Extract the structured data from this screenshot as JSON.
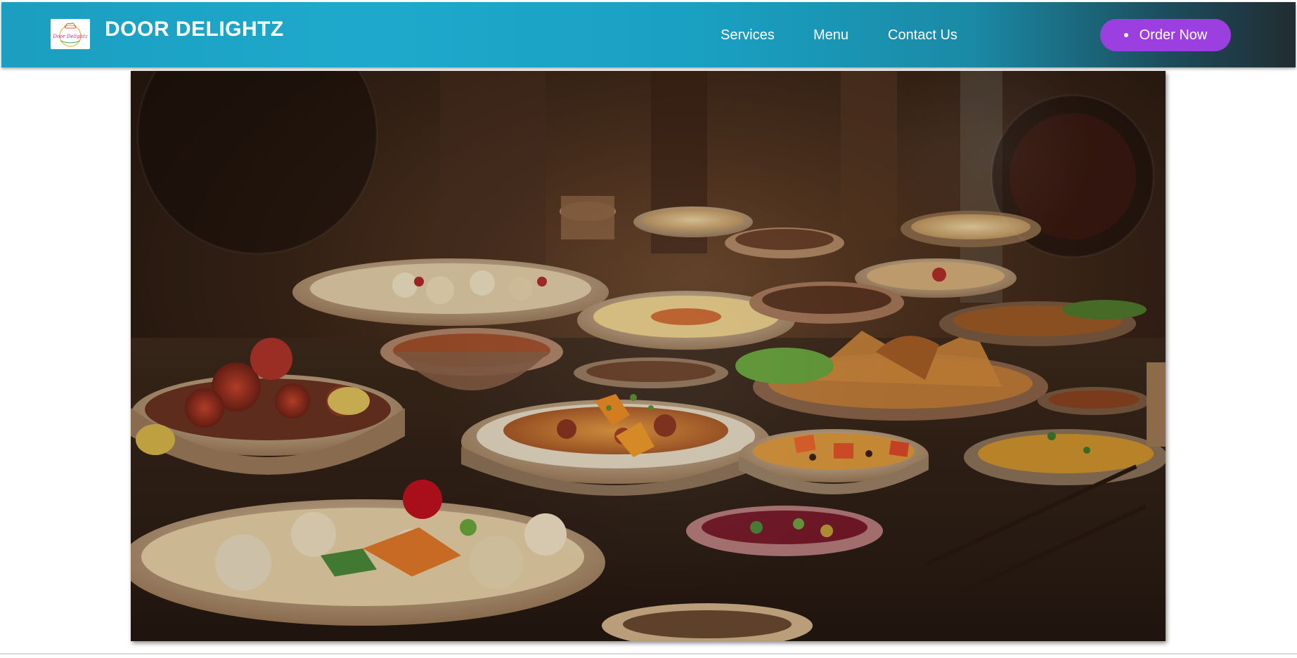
{
  "brand": {
    "name": "DOOR DELIGHTZ",
    "logo_text": "Door Delightz",
    "logo_icon": "chef-hat-icon"
  },
  "nav": {
    "items": [
      {
        "label": "Services"
      },
      {
        "label": "Menu"
      },
      {
        "label": "Contact Us"
      }
    ],
    "cta_label": "Order Now"
  },
  "colors": {
    "navbar_start": "#1b9ec0",
    "navbar_end": "#222c32",
    "cta": "#9b3fe0",
    "page_background": "#ffffff"
  },
  "hero": {
    "image": "food-spread-photo"
  }
}
